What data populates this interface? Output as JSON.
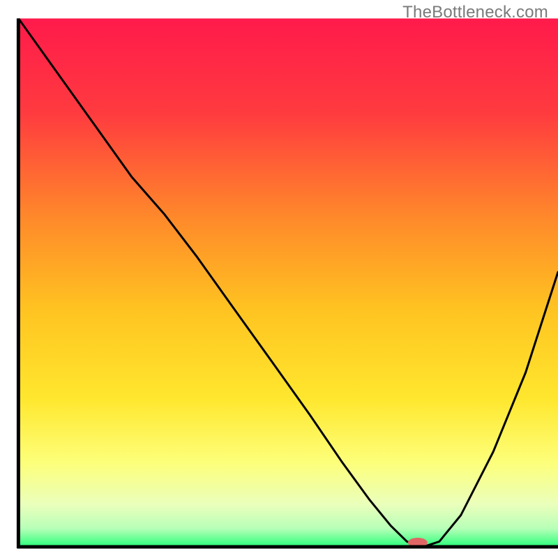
{
  "watermark": "TheBottleneck.com",
  "chart_data": {
    "type": "line",
    "title": "",
    "xlabel": "",
    "ylabel": "",
    "xlim": [
      0,
      100
    ],
    "ylim": [
      0,
      100
    ],
    "grid": false,
    "legend": false,
    "background_gradient": {
      "stops": [
        {
          "offset": 0.0,
          "color": "#ff1a4b"
        },
        {
          "offset": 0.18,
          "color": "#ff3b3f"
        },
        {
          "offset": 0.38,
          "color": "#ff8a2a"
        },
        {
          "offset": 0.55,
          "color": "#ffc321"
        },
        {
          "offset": 0.72,
          "color": "#ffe72e"
        },
        {
          "offset": 0.84,
          "color": "#fdff7a"
        },
        {
          "offset": 0.92,
          "color": "#eaffbb"
        },
        {
          "offset": 0.965,
          "color": "#b8ffb8"
        },
        {
          "offset": 1.0,
          "color": "#2aff7a"
        }
      ]
    },
    "series": [
      {
        "name": "bottleneck-curve",
        "color": "#000000",
        "x": [
          0,
          7,
          14,
          21,
          27,
          33,
          40,
          47,
          54,
          60,
          65,
          69,
          72,
          75,
          78,
          82,
          88,
          94,
          100
        ],
        "y": [
          100,
          90,
          80,
          70,
          63,
          55,
          45,
          35,
          25,
          16,
          9,
          4,
          1,
          0,
          1,
          6,
          18,
          33,
          52
        ]
      }
    ],
    "flat_segment": {
      "x_start": 69,
      "x_end": 76,
      "y": 0
    },
    "marker": {
      "name": "optimal-point",
      "x": 74,
      "y": 0.8,
      "color": "#e06666",
      "rx": 14,
      "ry": 7
    },
    "axes": {
      "left": {
        "x": 3.3,
        "y0": 3.3,
        "y1": 98
      },
      "bottom": {
        "y": 98,
        "x0": 3.3,
        "x1": 100
      }
    }
  }
}
